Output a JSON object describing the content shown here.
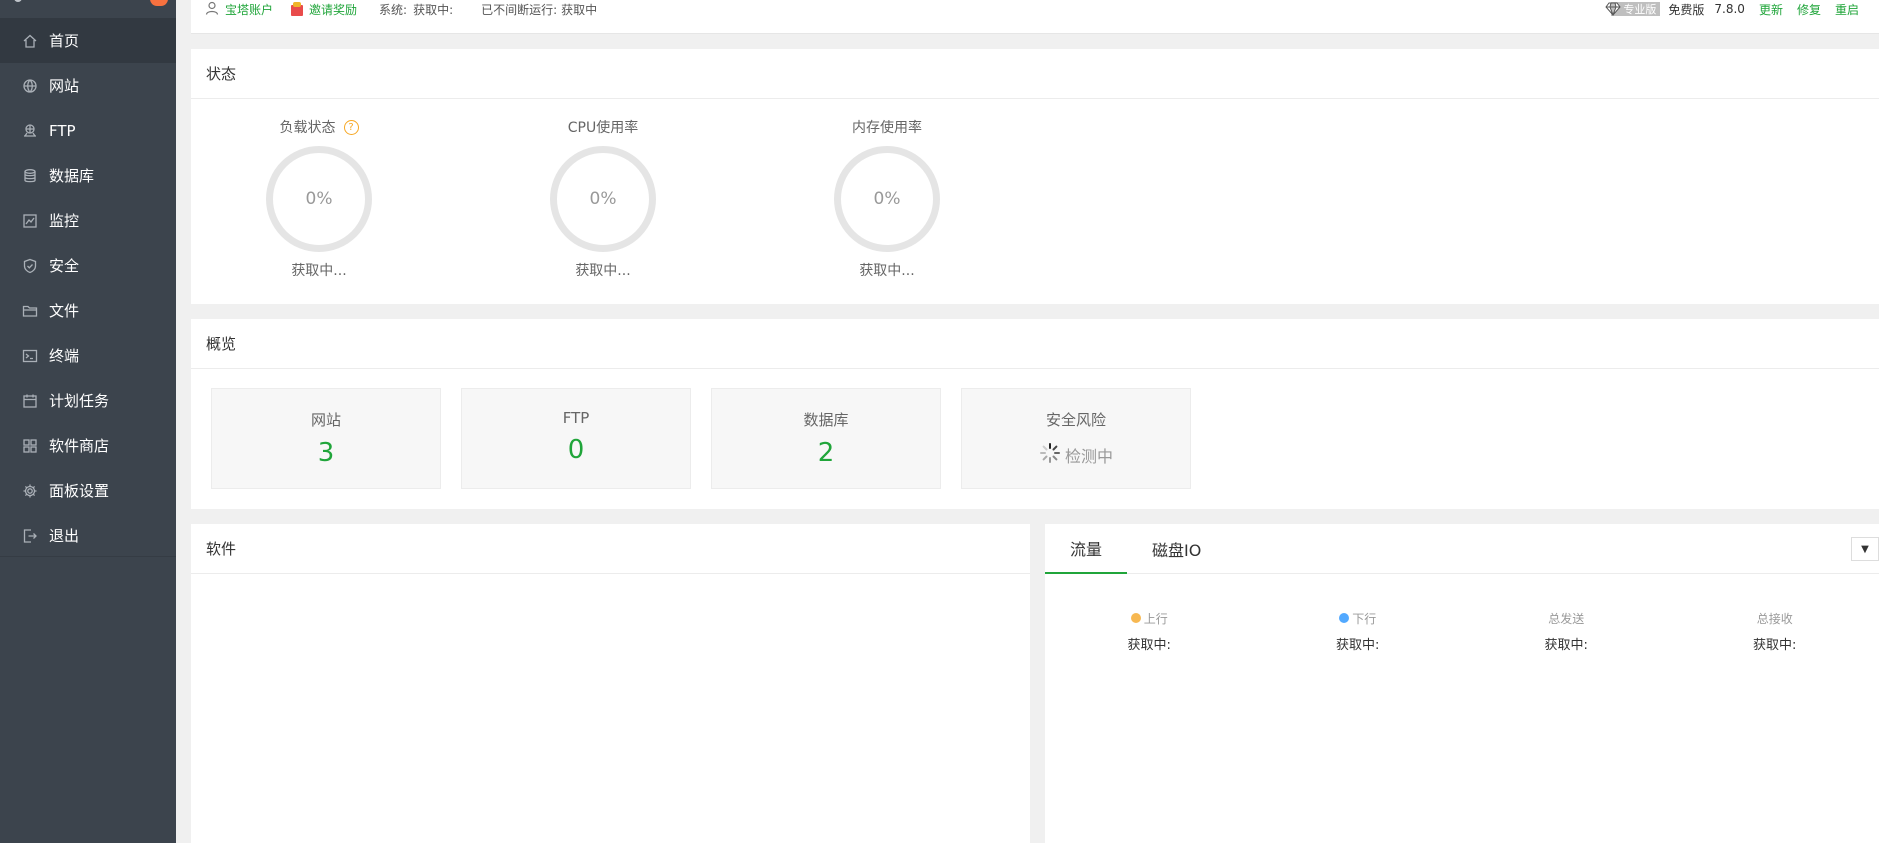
{
  "topbar": {
    "account_label": "宝塔账户",
    "invite_label": "邀请奖励",
    "system_label": "系统:",
    "system_value": "获取中:",
    "uptime_label": "已不间断运行:",
    "uptime_value": "获取中",
    "pro_label": "专业版",
    "free_label": "免费版",
    "version": "7.8.0",
    "update_label": "更新",
    "repair_label": "修复",
    "restart_label": "重启"
  },
  "sidebar": {
    "items": [
      {
        "label": "首页",
        "icon": "home-icon"
      },
      {
        "label": "网站",
        "icon": "globe-icon"
      },
      {
        "label": "FTP",
        "icon": "ftp-icon"
      },
      {
        "label": "数据库",
        "icon": "database-icon"
      },
      {
        "label": "监控",
        "icon": "monitor-icon"
      },
      {
        "label": "安全",
        "icon": "shield-icon"
      },
      {
        "label": "文件",
        "icon": "folder-icon"
      },
      {
        "label": "终端",
        "icon": "terminal-icon"
      },
      {
        "label": "计划任务",
        "icon": "calendar-icon"
      },
      {
        "label": "软件商店",
        "icon": "apps-icon"
      },
      {
        "label": "面板设置",
        "icon": "gear-icon"
      },
      {
        "label": "退出",
        "icon": "logout-icon"
      }
    ]
  },
  "status": {
    "title": "状态",
    "load": {
      "title": "负载状态",
      "help": "?",
      "value": "0%",
      "status": "获取中..."
    },
    "cpu": {
      "title": "CPU使用率",
      "value": "0%",
      "status": "获取中..."
    },
    "memory": {
      "title": "内存使用率",
      "value": "0%",
      "status": "获取中..."
    }
  },
  "overview": {
    "title": "概览",
    "website": {
      "label": "网站",
      "value": "3"
    },
    "ftp": {
      "label": "FTP",
      "value": "0"
    },
    "database": {
      "label": "数据库",
      "value": "2"
    },
    "security": {
      "label": "安全风险",
      "value": "检测中"
    }
  },
  "software": {
    "title": "软件"
  },
  "traffic": {
    "tabs": [
      "流量",
      "磁盘IO"
    ],
    "dropdown_glyph": "▼",
    "stats": [
      {
        "label": "上行",
        "value": "获取中:",
        "color": "#f7b851"
      },
      {
        "label": "下行",
        "value": "获取中:",
        "color": "#52a9ff"
      },
      {
        "label": "总发送",
        "value": "获取中:"
      },
      {
        "label": "总接收",
        "value": "获取中:"
      }
    ]
  },
  "colors": {
    "accent": "#20a53a",
    "sidebar_bg": "#3c444d",
    "sidebar_active": "#323941",
    "badge": "#f7713f"
  }
}
